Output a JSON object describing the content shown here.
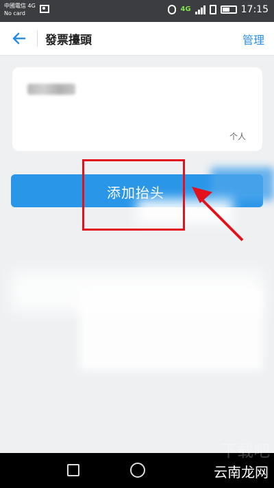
{
  "status_bar": {
    "carrier_line1": "中國電信 4G",
    "carrier_line2": "No card",
    "network_type": "4G",
    "time": "17:15"
  },
  "header": {
    "title": "發票擡頭",
    "manage_label": "管理"
  },
  "invoice_card": {
    "type_tag": "个人"
  },
  "add_button": {
    "label": "添加抬头"
  },
  "watermark": {
    "site": "云南龙网",
    "faint": "下载吧"
  },
  "colors": {
    "accent": "#2a96e8",
    "link": "#2a8de2",
    "annotation": "#e3111b"
  },
  "icons": {
    "back": "back-arrow-icon",
    "home": "home-circle-icon",
    "back_nav": "square-nav-icon"
  }
}
